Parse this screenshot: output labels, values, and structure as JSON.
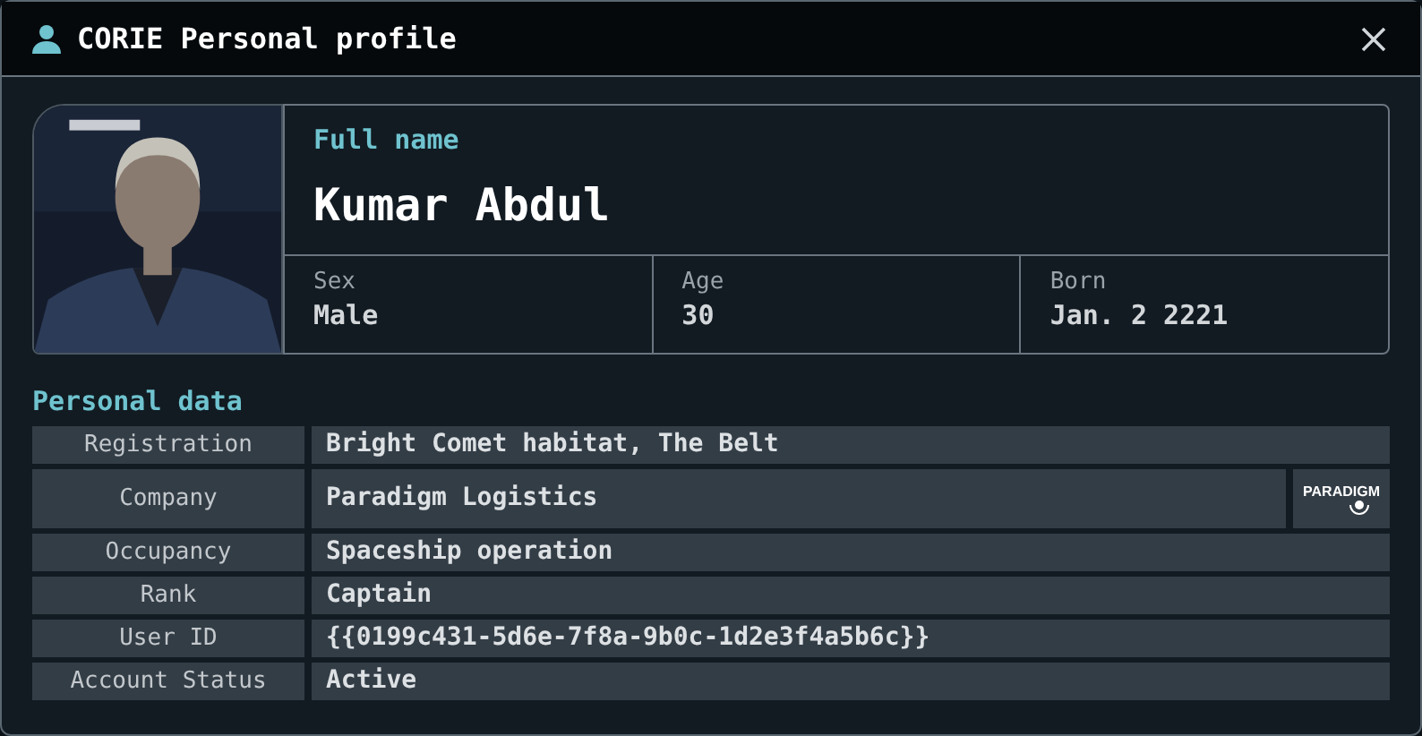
{
  "window": {
    "title": "CORIE Personal profile"
  },
  "profile": {
    "name_label": "Full name",
    "name": "Kumar Abdul",
    "facts": [
      {
        "label": "Sex",
        "value": "Male"
      },
      {
        "label": "Age",
        "value": "30"
      },
      {
        "label": "Born",
        "value": "Jan. 2 2221"
      }
    ]
  },
  "personal_data": {
    "heading": "Personal data",
    "rows": [
      {
        "label": "Registration",
        "value": "Bright Comet habitat, The Belt"
      },
      {
        "label": "Company",
        "value": "Paradigm Logistics",
        "logo": "PARADIGM"
      },
      {
        "label": "Occupancy",
        "value": "Spaceship operation"
      },
      {
        "label": "Rank",
        "value": "Captain"
      },
      {
        "label": "User ID",
        "value": "{{0199c431-5d6e-7f8a-9b0c-1d2e3f4a5b6c}}"
      },
      {
        "label": "Account Status",
        "value": "Active"
      }
    ]
  }
}
